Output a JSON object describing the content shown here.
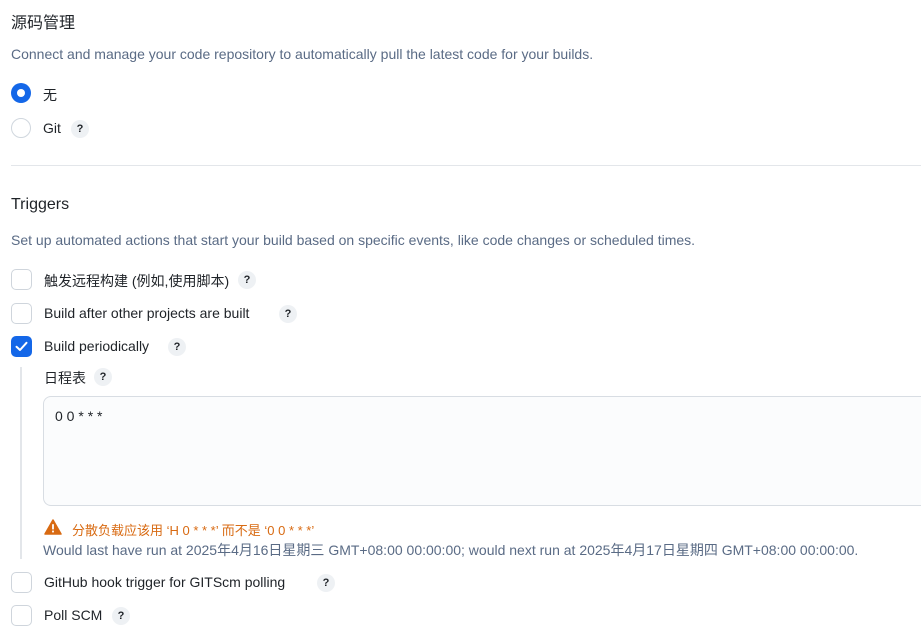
{
  "scm": {
    "title": "源码管理",
    "description": "Connect and manage your code repository to automatically pull the latest code for your builds.",
    "options": [
      {
        "label": "无",
        "selected": true
      },
      {
        "label": "Git",
        "selected": false,
        "help": "?"
      }
    ]
  },
  "triggers": {
    "title": "Triggers",
    "description": "Set up automated actions that start your build based on specific events, like code changes or scheduled times.",
    "items": [
      {
        "label": "触发远程构建 (例如,使用脚本)",
        "checked": false,
        "help": "?"
      },
      {
        "label": "Build after other projects are built",
        "checked": false,
        "help": "?"
      },
      {
        "label": "Build periodically",
        "checked": true,
        "help": "?"
      },
      {
        "label": "GitHub hook trigger for GITScm polling",
        "checked": false,
        "help": "?"
      },
      {
        "label": "Poll SCM",
        "checked": false,
        "help": "?"
      }
    ],
    "schedule": {
      "label": "日程表",
      "help": "?",
      "value": "0 0 * * *",
      "warning": "分散负载应该用 ‘H 0 * * *’ 而不是 ‘0 0 * * *’",
      "info": "Would last have run at 2025年4月16日星期三 GMT+08:00 00:00:00; would next run at 2025年4月17日星期四 GMT+08:00 00:00:00."
    }
  },
  "colors": {
    "accent": "#1467e8",
    "warning": "#d86a12",
    "muted": "#5a6b85"
  }
}
